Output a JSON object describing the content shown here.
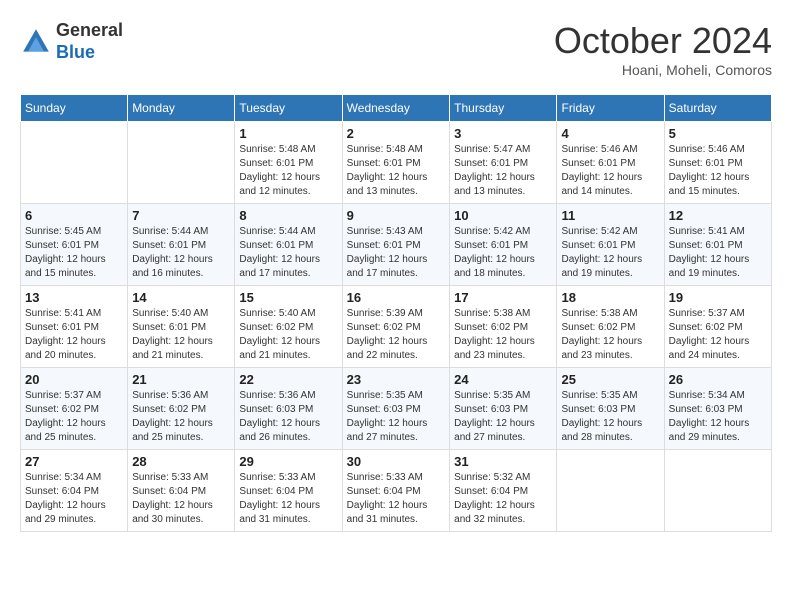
{
  "header": {
    "logo": {
      "line1": "General",
      "line2": "Blue"
    },
    "title": "October 2024",
    "location": "Hoani, Moheli, Comoros"
  },
  "weekdays": [
    "Sunday",
    "Monday",
    "Tuesday",
    "Wednesday",
    "Thursday",
    "Friday",
    "Saturday"
  ],
  "weeks": [
    [
      {
        "day": "",
        "info": ""
      },
      {
        "day": "",
        "info": ""
      },
      {
        "day": "1",
        "info": "Sunrise: 5:48 AM\nSunset: 6:01 PM\nDaylight: 12 hours\nand 12 minutes."
      },
      {
        "day": "2",
        "info": "Sunrise: 5:48 AM\nSunset: 6:01 PM\nDaylight: 12 hours\nand 13 minutes."
      },
      {
        "day": "3",
        "info": "Sunrise: 5:47 AM\nSunset: 6:01 PM\nDaylight: 12 hours\nand 13 minutes."
      },
      {
        "day": "4",
        "info": "Sunrise: 5:46 AM\nSunset: 6:01 PM\nDaylight: 12 hours\nand 14 minutes."
      },
      {
        "day": "5",
        "info": "Sunrise: 5:46 AM\nSunset: 6:01 PM\nDaylight: 12 hours\nand 15 minutes."
      }
    ],
    [
      {
        "day": "6",
        "info": "Sunrise: 5:45 AM\nSunset: 6:01 PM\nDaylight: 12 hours\nand 15 minutes."
      },
      {
        "day": "7",
        "info": "Sunrise: 5:44 AM\nSunset: 6:01 PM\nDaylight: 12 hours\nand 16 minutes."
      },
      {
        "day": "8",
        "info": "Sunrise: 5:44 AM\nSunset: 6:01 PM\nDaylight: 12 hours\nand 17 minutes."
      },
      {
        "day": "9",
        "info": "Sunrise: 5:43 AM\nSunset: 6:01 PM\nDaylight: 12 hours\nand 17 minutes."
      },
      {
        "day": "10",
        "info": "Sunrise: 5:42 AM\nSunset: 6:01 PM\nDaylight: 12 hours\nand 18 minutes."
      },
      {
        "day": "11",
        "info": "Sunrise: 5:42 AM\nSunset: 6:01 PM\nDaylight: 12 hours\nand 19 minutes."
      },
      {
        "day": "12",
        "info": "Sunrise: 5:41 AM\nSunset: 6:01 PM\nDaylight: 12 hours\nand 19 minutes."
      }
    ],
    [
      {
        "day": "13",
        "info": "Sunrise: 5:41 AM\nSunset: 6:01 PM\nDaylight: 12 hours\nand 20 minutes."
      },
      {
        "day": "14",
        "info": "Sunrise: 5:40 AM\nSunset: 6:01 PM\nDaylight: 12 hours\nand 21 minutes."
      },
      {
        "day": "15",
        "info": "Sunrise: 5:40 AM\nSunset: 6:02 PM\nDaylight: 12 hours\nand 21 minutes."
      },
      {
        "day": "16",
        "info": "Sunrise: 5:39 AM\nSunset: 6:02 PM\nDaylight: 12 hours\nand 22 minutes."
      },
      {
        "day": "17",
        "info": "Sunrise: 5:38 AM\nSunset: 6:02 PM\nDaylight: 12 hours\nand 23 minutes."
      },
      {
        "day": "18",
        "info": "Sunrise: 5:38 AM\nSunset: 6:02 PM\nDaylight: 12 hours\nand 23 minutes."
      },
      {
        "day": "19",
        "info": "Sunrise: 5:37 AM\nSunset: 6:02 PM\nDaylight: 12 hours\nand 24 minutes."
      }
    ],
    [
      {
        "day": "20",
        "info": "Sunrise: 5:37 AM\nSunset: 6:02 PM\nDaylight: 12 hours\nand 25 minutes."
      },
      {
        "day": "21",
        "info": "Sunrise: 5:36 AM\nSunset: 6:02 PM\nDaylight: 12 hours\nand 25 minutes."
      },
      {
        "day": "22",
        "info": "Sunrise: 5:36 AM\nSunset: 6:03 PM\nDaylight: 12 hours\nand 26 minutes."
      },
      {
        "day": "23",
        "info": "Sunrise: 5:35 AM\nSunset: 6:03 PM\nDaylight: 12 hours\nand 27 minutes."
      },
      {
        "day": "24",
        "info": "Sunrise: 5:35 AM\nSunset: 6:03 PM\nDaylight: 12 hours\nand 27 minutes."
      },
      {
        "day": "25",
        "info": "Sunrise: 5:35 AM\nSunset: 6:03 PM\nDaylight: 12 hours\nand 28 minutes."
      },
      {
        "day": "26",
        "info": "Sunrise: 5:34 AM\nSunset: 6:03 PM\nDaylight: 12 hours\nand 29 minutes."
      }
    ],
    [
      {
        "day": "27",
        "info": "Sunrise: 5:34 AM\nSunset: 6:04 PM\nDaylight: 12 hours\nand 29 minutes."
      },
      {
        "day": "28",
        "info": "Sunrise: 5:33 AM\nSunset: 6:04 PM\nDaylight: 12 hours\nand 30 minutes."
      },
      {
        "day": "29",
        "info": "Sunrise: 5:33 AM\nSunset: 6:04 PM\nDaylight: 12 hours\nand 31 minutes."
      },
      {
        "day": "30",
        "info": "Sunrise: 5:33 AM\nSunset: 6:04 PM\nDaylight: 12 hours\nand 31 minutes."
      },
      {
        "day": "31",
        "info": "Sunrise: 5:32 AM\nSunset: 6:04 PM\nDaylight: 12 hours\nand 32 minutes."
      },
      {
        "day": "",
        "info": ""
      },
      {
        "day": "",
        "info": ""
      }
    ]
  ]
}
